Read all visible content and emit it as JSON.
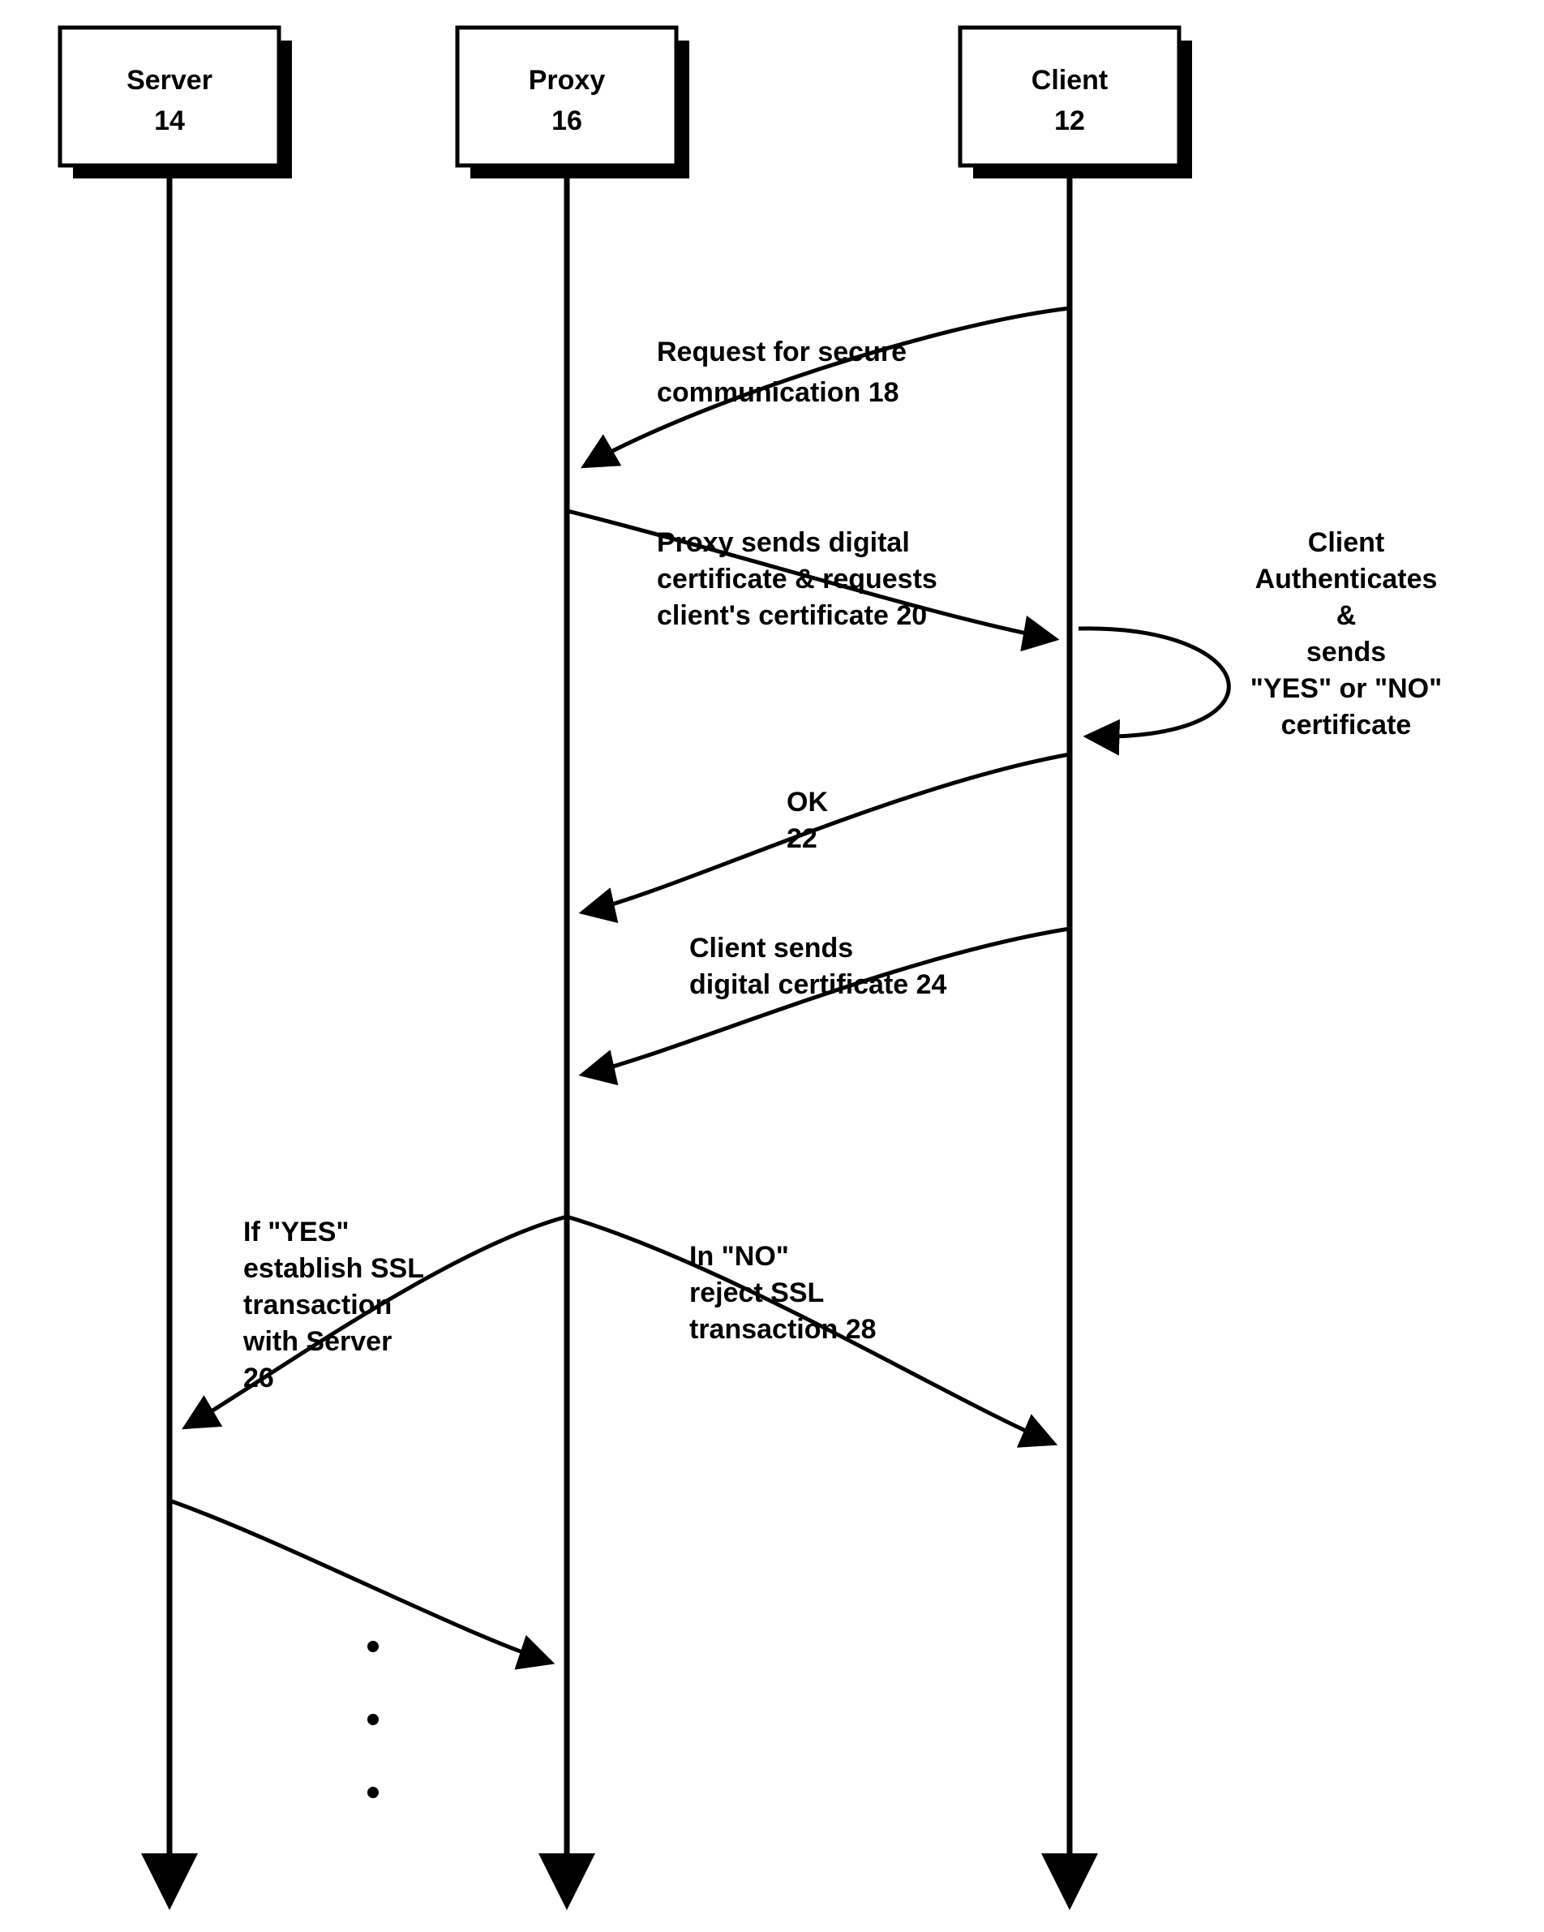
{
  "participants": {
    "server": {
      "name": "Server",
      "ref": "14"
    },
    "proxy": {
      "name": "Proxy",
      "ref": "16"
    },
    "client": {
      "name": "Client",
      "ref": "12"
    }
  },
  "messages": {
    "m18": {
      "line1": "Request for secure",
      "line2": "communication 18"
    },
    "m20": {
      "line1": "Proxy sends digital",
      "line2": "certificate & requests",
      "line3": "client's certificate 20"
    },
    "m22": {
      "line1": "OK",
      "line2": "22"
    },
    "m24": {
      "line1": "Client sends",
      "line2": "digital certificate 24"
    },
    "m26": {
      "line1": "If \"YES\"",
      "line2": "establish SSL",
      "line3": "transaction",
      "line4": "with Server",
      "line5": "26"
    },
    "m28": {
      "line1": "In \"NO\"",
      "line2": "reject SSL",
      "line3": "transaction 28"
    }
  },
  "annotations": {
    "clientAuth": {
      "line1": "Client",
      "line2": "Authenticates",
      "line3": "&",
      "line4": "sends",
      "line5": "\"YES\" or \"NO\"",
      "line6": "certificate"
    }
  }
}
